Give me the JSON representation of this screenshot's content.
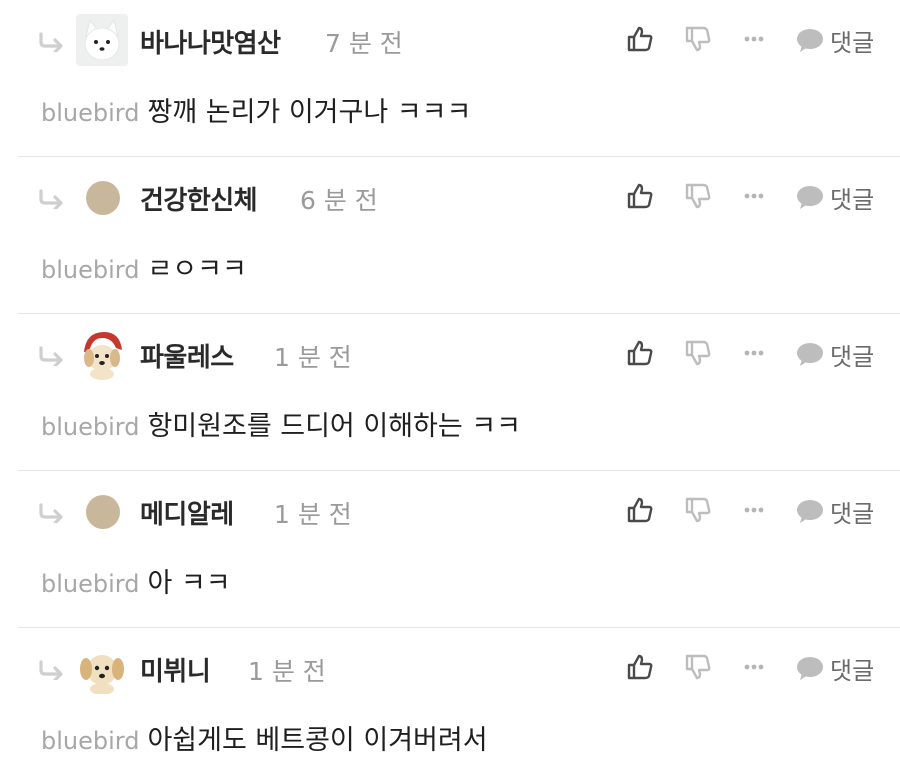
{
  "comments": [
    {
      "nickname": "바나나맛염산",
      "time": "7 분 전",
      "mention": "bluebird",
      "text": "짱깨 논리가 이거구나 ㅋㅋㅋ",
      "avatar": "white-dog-avatar",
      "reply_label": "댓글"
    },
    {
      "nickname": "건강한신체",
      "time": "6 분 전",
      "mention": "bluebird",
      "text": "ㄹㅇㅋㅋ",
      "avatar": "default-avatar",
      "reply_label": "댓글"
    },
    {
      "nickname": "파울레스",
      "time": "1 분 전",
      "mention": "bluebird",
      "text": "항미원조를 드디어 이해하는 ㅋㅋ",
      "avatar": "puppy-red-hood-avatar",
      "reply_label": "댓글"
    },
    {
      "nickname": "메디알레",
      "time": "1 분 전",
      "mention": "bluebird",
      "text": "아 ㅋㅋ",
      "avatar": "default-avatar",
      "reply_label": "댓글"
    },
    {
      "nickname": "미뷔니",
      "time": "1 분 전",
      "mention": "bluebird",
      "text": "아쉽게도 베트콩이 이겨버려서",
      "avatar": "puppy-avatar",
      "reply_label": "댓글"
    }
  ],
  "icons": {
    "like": "thumbs-up-icon",
    "dislike": "thumbs-down-icon",
    "more": "more-dots-icon",
    "reply": "speech-bubble-icon",
    "reply_arrow": "reply-arrow-icon"
  },
  "colors": {
    "text": "#1f1f1f",
    "mention": "#a7a7a7",
    "time": "#9a9a9a",
    "icon": "#4a4a4a",
    "icon_light": "#bdbdbd",
    "divider": "#e6e6e6"
  }
}
